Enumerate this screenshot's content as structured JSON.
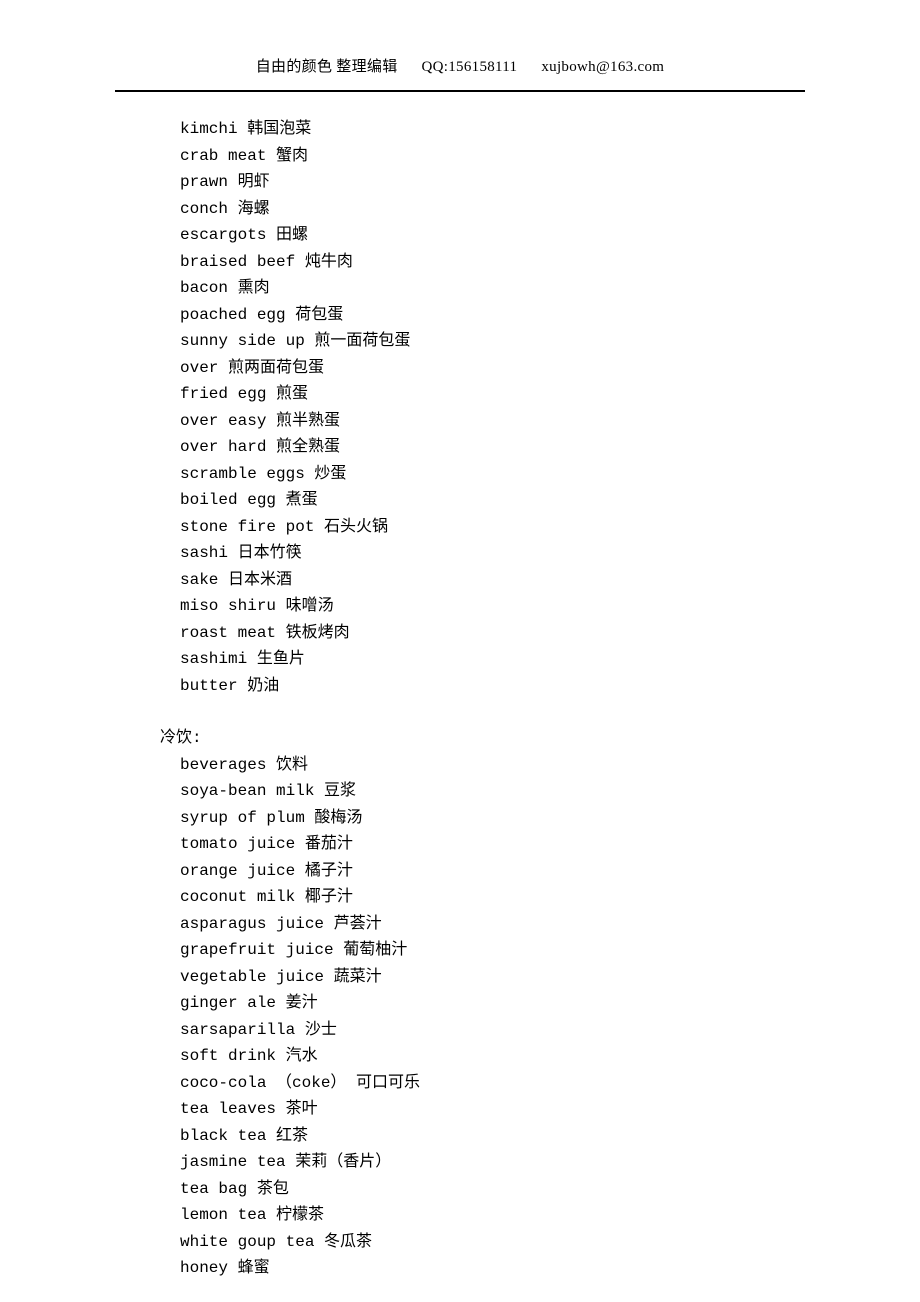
{
  "header": {
    "left": "自由的颜色 整理编辑",
    "qq": "QQ:156158111",
    "email": "xujbowh@163.com"
  },
  "lists": {
    "food": [
      "kimchi 韩国泡菜",
      "crab meat 蟹肉",
      "prawn 明虾",
      "conch 海螺",
      "escargots 田螺",
      "braised beef 炖牛肉",
      "bacon 熏肉",
      "poached egg 荷包蛋",
      "sunny side up 煎一面荷包蛋",
      "over 煎两面荷包蛋",
      "fried egg 煎蛋",
      "over easy 煎半熟蛋",
      "over hard 煎全熟蛋",
      "scramble eggs 炒蛋",
      "boiled egg 煮蛋",
      "stone fire pot 石头火锅",
      "sashi 日本竹筷",
      "sake 日本米酒",
      "miso shiru 味噌汤",
      "roast meat 铁板烤肉",
      "sashimi 生鱼片",
      "butter 奶油"
    ],
    "drinks_title": "冷饮:",
    "drinks": [
      "beverages 饮料",
      "soya-bean milk 豆浆",
      "syrup of plum 酸梅汤",
      "tomato juice 番茄汁",
      "orange juice 橘子汁",
      "coconut milk 椰子汁",
      "asparagus juice 芦荟汁",
      "grapefruit juice 葡萄柚汁",
      "vegetable juice 蔬菜汁",
      "ginger ale 姜汁",
      "sarsaparilla 沙士",
      "soft drink 汽水",
      "coco-cola （coke） 可口可乐",
      "tea leaves 茶叶",
      "black tea 红茶",
      "jasmine tea 茉莉（香片）",
      "tea bag 茶包",
      "lemon tea 柠檬茶",
      "white goup tea 冬瓜茶",
      "honey 蜂蜜"
    ]
  }
}
